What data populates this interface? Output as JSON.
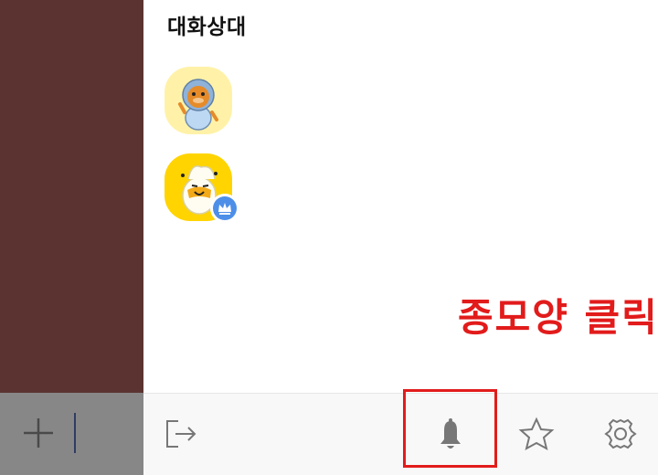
{
  "drawer": {
    "title": "대화상대",
    "members": [
      {
        "name": "ryan-avatar",
        "role": "member"
      },
      {
        "name": "muzi-avatar",
        "role": "owner",
        "badge": "crown-icon"
      }
    ]
  },
  "annotation": {
    "instruction": "종모양 클릭",
    "highlight_color": "#e21b1b"
  },
  "input_bar": {
    "plus_icon": "plus-icon"
  },
  "toolbar": {
    "exit_icon": "exit-icon",
    "bell_icon": "bell-icon",
    "star_icon": "star-icon",
    "settings_icon": "gear-icon"
  },
  "colors": {
    "left_panel": "#5b3431",
    "left_bottom_bar": "#878787",
    "toolbar_bg": "#f8f8f8",
    "crown_badge": "#4d8fe8",
    "member_1_bg": "#fff2a8",
    "member_2_bg": "#ffd400"
  }
}
